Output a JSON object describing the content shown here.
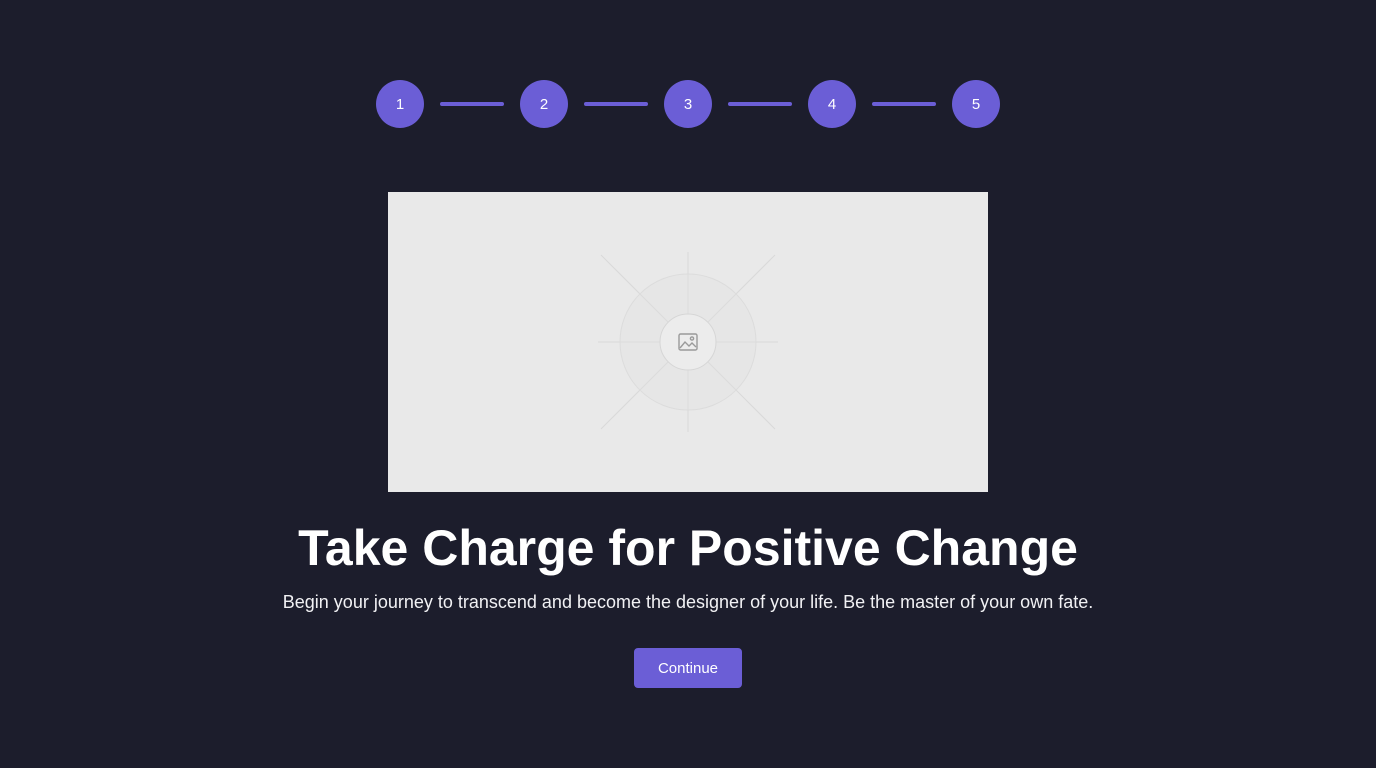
{
  "stepper": {
    "steps": [
      {
        "label": "1"
      },
      {
        "label": "2"
      },
      {
        "label": "3"
      },
      {
        "label": "4"
      },
      {
        "label": "5"
      }
    ]
  },
  "hero": {
    "icon": "image-placeholder-icon"
  },
  "content": {
    "title": "Take Charge for Positive Change",
    "subtitle": "Begin your journey to transcend and become the designer of your life. Be the master of your own fate."
  },
  "actions": {
    "continue_label": "Continue"
  },
  "colors": {
    "background": "#1c1d2c",
    "accent": "#6b5ed6",
    "placeholder": "#e9e9e9"
  }
}
